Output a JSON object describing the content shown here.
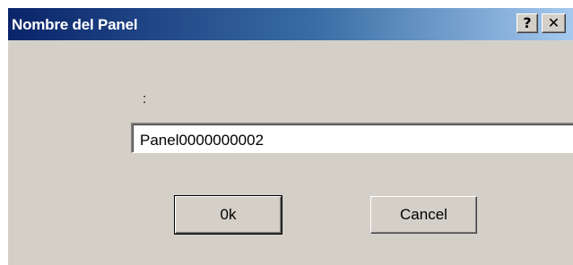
{
  "dialog": {
    "title": "Nombre del Panel",
    "help_button": "?",
    "close_button": "✕",
    "prompt_label": ":",
    "name_value": "Panel0000000002",
    "ok_label": "0k",
    "cancel_label": "Cancel"
  },
  "colors": {
    "title_start": "#0a246a",
    "title_end": "#a6caf0",
    "face": "#d4d0c8"
  }
}
